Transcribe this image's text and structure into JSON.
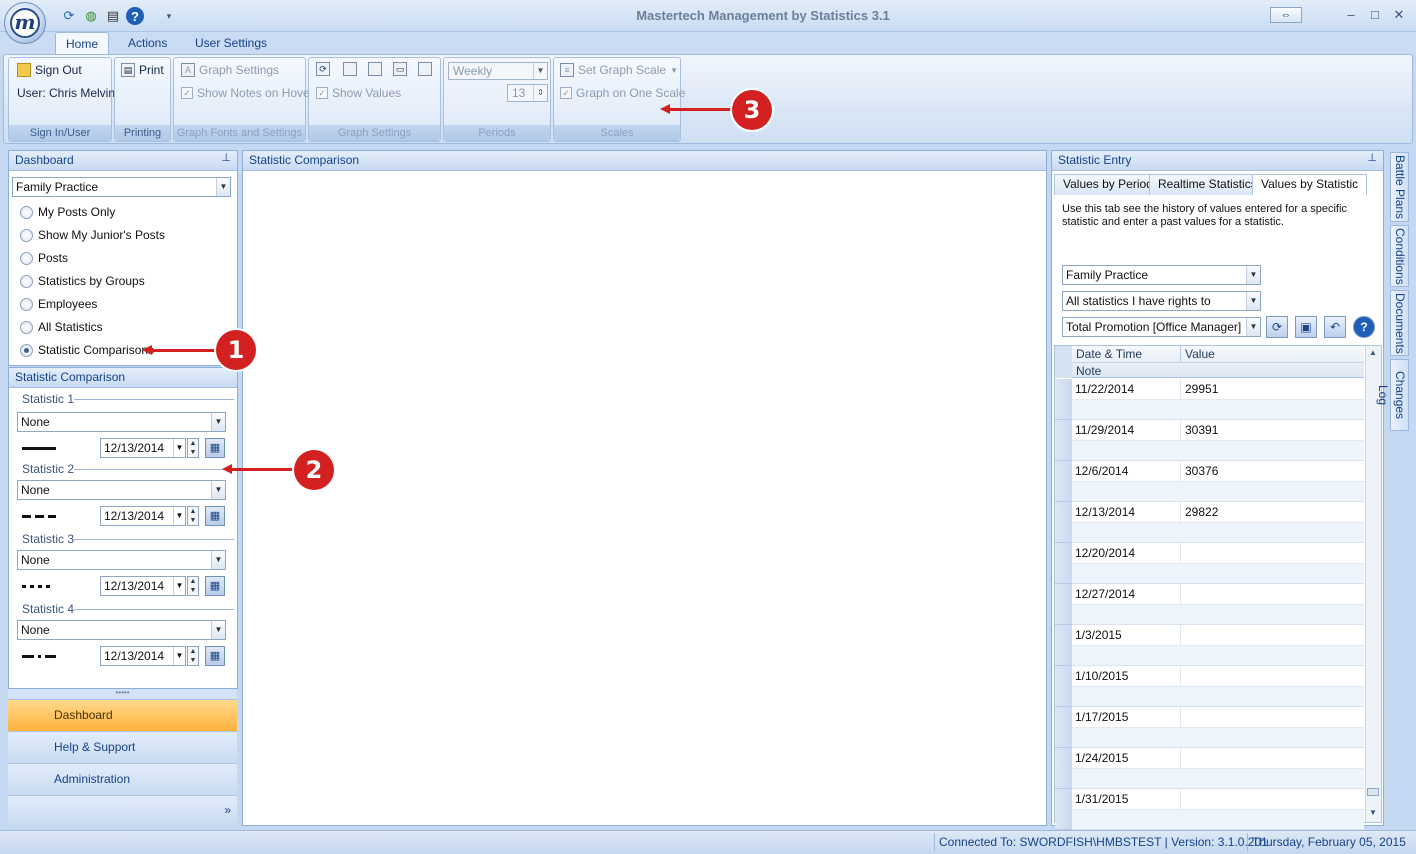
{
  "window": {
    "title": "Mastertech Management by Statistics 3.1",
    "logo_letter": "m",
    "restore_icon": "⇔",
    "min": "–",
    "max": "□",
    "close": "✕",
    "qat_icons": [
      "refresh-icon",
      "globe-icon",
      "printer-icon",
      "help-icon"
    ]
  },
  "ribbon": {
    "tabs": [
      "Home",
      "Actions",
      "User Settings"
    ],
    "groups": {
      "signin": {
        "label": "Sign In/User",
        "sign_out": "Sign Out",
        "user": "User: Chris Melvin"
      },
      "printing": {
        "label": "Printing",
        "print": "Print"
      },
      "graph_fonts": {
        "label": "Graph Fonts and Settings",
        "graph_settings": "Graph Settings",
        "show_notes": "Show Notes on Hover"
      },
      "graph_settings": {
        "label": "Graph Settings",
        "show_values": "Show Values"
      },
      "periods": {
        "label": "Periods",
        "period": "Weekly",
        "count": "13"
      },
      "scales": {
        "label": "Scales",
        "set_graph_scale": "Set Graph Scale",
        "graph_on_one_scale": "Graph on One Scale"
      }
    }
  },
  "dashboard": {
    "title": "Dashboard",
    "selected": "Family Practice",
    "options": [
      {
        "label": "My Posts Only",
        "checked": false
      },
      {
        "label": "Show My Junior's Posts",
        "checked": false
      },
      {
        "label": "Posts",
        "checked": false
      },
      {
        "label": "Statistics by Groups",
        "checked": false
      },
      {
        "label": "Employees",
        "checked": false
      },
      {
        "label": "All Statistics",
        "checked": false
      },
      {
        "label": "Statistic Comparisons",
        "checked": true
      }
    ]
  },
  "comparison": {
    "title": "Statistic Comparison",
    "stats": [
      {
        "label": "Statistic 1",
        "value": "None",
        "date": "12/13/2014",
        "line": "solid"
      },
      {
        "label": "Statistic 2",
        "value": "None",
        "date": "12/13/2014",
        "line": "dashed"
      },
      {
        "label": "Statistic 3",
        "value": "None",
        "date": "12/13/2014",
        "line": "dotted"
      },
      {
        "label": "Statistic 4",
        "value": "None",
        "date": "12/13/2014",
        "line": "dashdot"
      }
    ]
  },
  "nav": [
    "Dashboard",
    "Help & Support",
    "Administration"
  ],
  "center": {
    "title": "Statistic Comparison"
  },
  "entry": {
    "title": "Statistic Entry",
    "tabs": [
      "Values by Period",
      "Realtime Statistics",
      "Values by Statistic"
    ],
    "active_tab": 2,
    "description": "Use this tab see the history of values entered for a specific statistic and enter a past values for a statistic.",
    "select1": "Family Practice",
    "select2": "All statistics I have rights to",
    "select3": "Total Promotion [Office Manager]",
    "grid": {
      "col_date": "Date & Time",
      "col_value": "Value",
      "col_note": "Note",
      "rows": [
        {
          "date": "11/22/2014",
          "value": "29951"
        },
        {
          "date": "11/29/2014",
          "value": "30391"
        },
        {
          "date": "12/6/2014",
          "value": "30376"
        },
        {
          "date": "12/13/2014",
          "value": "29822"
        },
        {
          "date": "12/20/2014",
          "value": ""
        },
        {
          "date": "12/27/2014",
          "value": ""
        },
        {
          "date": "1/3/2015",
          "value": ""
        },
        {
          "date": "1/10/2015",
          "value": ""
        },
        {
          "date": "1/17/2015",
          "value": ""
        },
        {
          "date": "1/24/2015",
          "value": ""
        },
        {
          "date": "1/31/2015",
          "value": ""
        }
      ]
    }
  },
  "side_tabs": [
    "Battle Plans",
    "Conditions",
    "Documents",
    "Changes Log"
  ],
  "status": {
    "connection": "Connected To: SWORDFISH\\HMBSTEST | Version: 3.1.0.201",
    "date": "Thursday, February 05, 2015"
  },
  "callouts": [
    "1",
    "2",
    "3"
  ],
  "colors": {
    "callout": "#d32020",
    "active_nav": "#ffb23c",
    "accent": "#15428b"
  }
}
